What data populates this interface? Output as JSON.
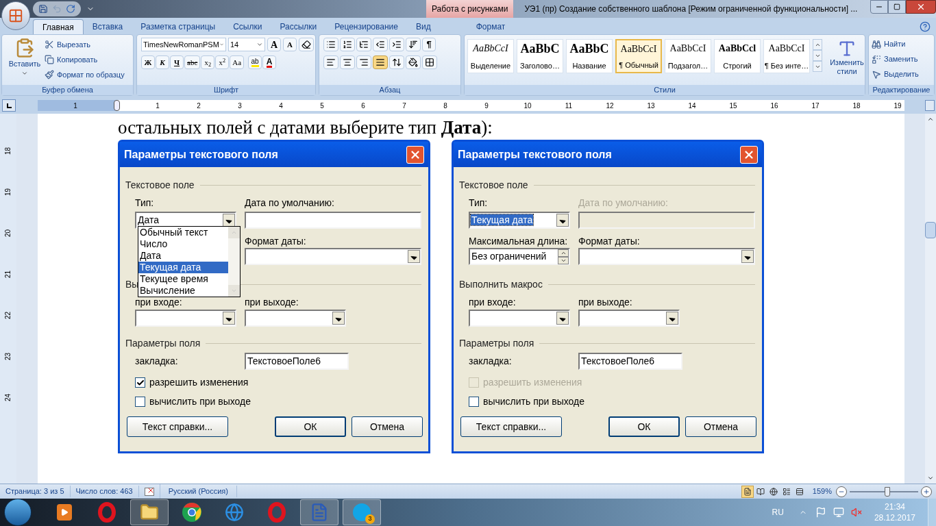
{
  "title_bar": {
    "contextual_group": "Работа с рисунками",
    "title": "УЭ1 (пр) Создание собственного шаблона [Режим ограниченной функциональности] ..."
  },
  "ribbon_tabs": [
    {
      "label": "Главная",
      "selected": true,
      "kind": "main"
    },
    {
      "label": "Вставка",
      "selected": false,
      "kind": "main"
    },
    {
      "label": "Разметка страницы",
      "selected": false,
      "kind": "main"
    },
    {
      "label": "Ссылки",
      "selected": false,
      "kind": "main"
    },
    {
      "label": "Рассылки",
      "selected": false,
      "kind": "main"
    },
    {
      "label": "Рецензирование",
      "selected": false,
      "kind": "main"
    },
    {
      "label": "Вид",
      "selected": false,
      "kind": "main"
    },
    {
      "label": "Формат",
      "selected": false,
      "kind": "contextual"
    }
  ],
  "clipboard": {
    "title": "Буфер обмена",
    "paste": "Вставить",
    "commands": [
      "Вырезать",
      "Копировать",
      "Формат по образцу"
    ]
  },
  "font": {
    "title": "Шрифт",
    "name": "TimesNewRomanPSM",
    "size": "14",
    "grow": "A",
    "shrink": "A",
    "highlight": "ab",
    "font_color_letter": "A",
    "formats": [
      {
        "label": "Ж",
        "kind": "bold"
      },
      {
        "label": "К",
        "kind": "italic"
      },
      {
        "label": "Ч",
        "kind": "underline"
      },
      {
        "label": "abc",
        "kind": "strike"
      },
      {
        "label": "x$_{2}$",
        "kind": "plain"
      },
      {
        "label": "x$^{2}$",
        "kind": "plain"
      },
      {
        "label": "Aa",
        "kind": "plain"
      }
    ]
  },
  "paragraph": {
    "title": "Абзац",
    "pilcrow": "¶",
    "alignment": [
      {
        "kind": "left",
        "selected": false
      },
      {
        "kind": "center",
        "selected": false
      },
      {
        "kind": "right",
        "selected": false
      },
      {
        "kind": "justify",
        "selected": true
      }
    ]
  },
  "styles": {
    "title": "Стили",
    "change": "Изменить стили",
    "items": [
      {
        "preview": "AaBbCcI",
        "label": "Выделение",
        "kind": "emphasis",
        "selected": false
      },
      {
        "preview": "AaBbC",
        "label": "Заголово…",
        "kind": "heading",
        "selected": false
      },
      {
        "preview": "AaBbC",
        "label": "Название",
        "kind": "heading",
        "selected": false
      },
      {
        "preview": "AaBbCcI",
        "label": "¶ Обычный",
        "kind": "normal",
        "selected": true
      },
      {
        "preview": "AaBbCcI",
        "label": "Подзагол…",
        "kind": "normal",
        "selected": false
      },
      {
        "preview": "AaBbCcl",
        "label": "Строгий",
        "kind": "strong",
        "selected": false
      },
      {
        "preview": "AaBbCcI",
        "label": "¶ Без инте…",
        "kind": "normal",
        "selected": false
      }
    ]
  },
  "editing": {
    "title": "Редактирование",
    "commands": [
      "Найти",
      "Заменить",
      "Выделить"
    ]
  },
  "ruler": {
    "horizontal": [
      "1",
      "1",
      "2",
      "3",
      "4",
      "5",
      "6",
      "7",
      "8",
      "9",
      "10",
      "11",
      "12",
      "13",
      "14",
      "15",
      "16",
      "17",
      "18",
      "19"
    ],
    "vertical": [
      "18",
      "19",
      "20",
      "21",
      "22",
      "23",
      "24"
    ]
  },
  "document": {
    "text": "остальных полей с датами выберите тип **Дата**):"
  },
  "dialogs": [
    {
      "title": "Параметры текстового поля",
      "section_field": "Текстовое поле",
      "type_label": "Тип:",
      "type_value": "Дата",
      "type_focused": false,
      "default_label": "Дата по умолчанию:",
      "default_disabled": false,
      "date_format_label": "Формат даты:",
      "macro_section": "Вы",
      "entry_label": "при входе:",
      "exit_label": "при выходе:",
      "options_section": "Параметры поля",
      "bookmark_label": "закладка:",
      "bookmark_value": "ТекстовоеПоле6",
      "checkboxes": [
        {
          "label": "разрешить изменения",
          "checked": true,
          "disabled": false
        },
        {
          "label": "вычислить при выходе",
          "checked": false,
          "disabled": false
        }
      ],
      "buttons": [
        "Текст справки...",
        "ОК",
        "Отмена"
      ],
      "dropdown": [
        {
          "label": "Обычный текст",
          "selected": false
        },
        {
          "label": "Число",
          "selected": false
        },
        {
          "label": "Дата",
          "selected": false
        },
        {
          "label": "Текущая дата",
          "selected": true
        },
        {
          "label": "Текущее время",
          "selected": false
        },
        {
          "label": "Вычисление",
          "selected": false
        }
      ]
    },
    {
      "title": "Параметры текстового поля",
      "section_field": "Текстовое поле",
      "type_label": "Тип:",
      "type_value": "Текущая дата",
      "type_focused": true,
      "default_label": "Дата по умолчанию:",
      "default_disabled": true,
      "max_length_label": "Максимальная длина:",
      "max_length_value": "Без ограничений",
      "date_format_label": "Формат даты:",
      "macro_section": "Выполнить макрос",
      "entry_label": "при входе:",
      "exit_label": "при выходе:",
      "options_section": "Параметры поля",
      "bookmark_label": "закладка:",
      "bookmark_value": "ТекстовоеПоле6",
      "checkboxes": [
        {
          "label": "разрешить изменения",
          "checked": false,
          "disabled": true
        },
        {
          "label": "вычислить при выходе",
          "checked": false,
          "disabled": false
        }
      ],
      "buttons": [
        "Текст справки...",
        "ОК",
        "Отмена"
      ]
    }
  ],
  "status_bar": {
    "items": [
      "Страница: 3 из 5",
      "Число слов: 463",
      "Русский (Россия)"
    ],
    "views": [
      {
        "selected": true
      },
      {
        "selected": false
      },
      {
        "selected": false
      },
      {
        "selected": false
      },
      {
        "selected": false
      }
    ],
    "zoom": "159%",
    "zoom_slider": {
      "level": 0.55
    }
  },
  "taskbar": {
    "apps": [
      {
        "kind": "media",
        "active": false
      },
      {
        "kind": "opera",
        "active": false
      },
      {
        "kind": "explorer",
        "active": true
      },
      {
        "kind": "chrome",
        "active": false
      },
      {
        "kind": "ie",
        "active": false
      },
      {
        "kind": "opera",
        "active": false
      },
      {
        "kind": "word",
        "active": true
      },
      {
        "kind": "skype",
        "active": true,
        "badge": "3"
      }
    ],
    "language": "RU",
    "time": "21:34",
    "date": "28.12.2017"
  }
}
